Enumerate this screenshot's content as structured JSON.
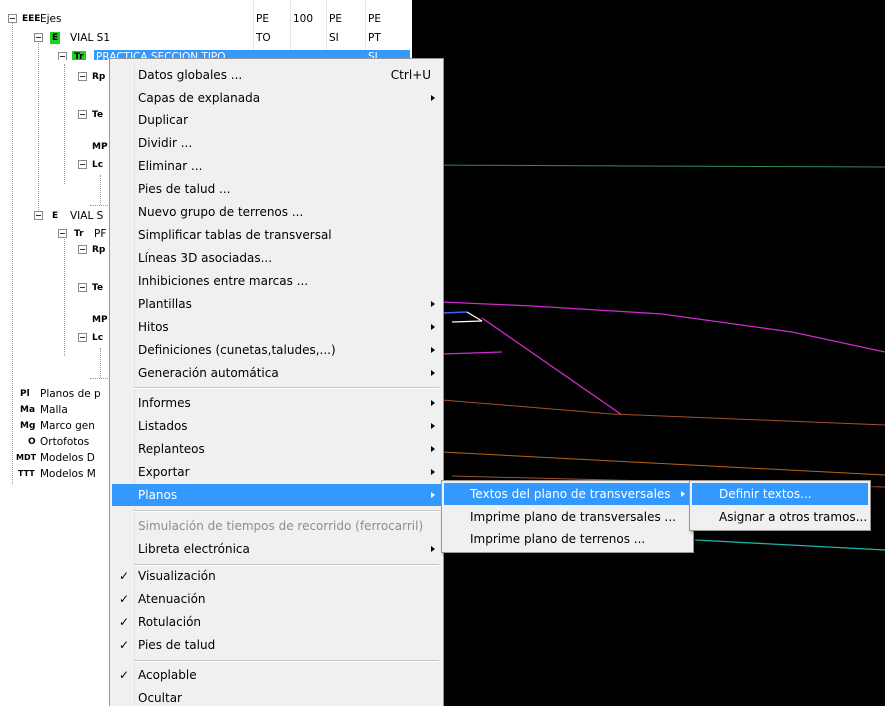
{
  "tree": {
    "rows": [
      {
        "icon": "EEE",
        "label": "Ejes",
        "c1": "PE",
        "c2": "100",
        "c3": "PE",
        "c4": "PE"
      },
      {
        "icon": "E",
        "label": "VIAL S1",
        "c1": "TO",
        "c2": "",
        "c3": "SI",
        "c4": "PT"
      },
      {
        "icon": "Tr",
        "label": "PRACTICA SECCION TIPO",
        "c1": "",
        "c2": "",
        "c3": "",
        "c4": "SI"
      },
      {
        "icon": "Rp",
        "label": "",
        "c1": "",
        "c2": "",
        "c3": "",
        "c4": ""
      },
      {
        "icon": "Te",
        "label": "",
        "c1": "",
        "c2": "",
        "c3": "",
        "c4": ""
      },
      {
        "icon": "MP",
        "label": "",
        "c1": "",
        "c2": "",
        "c3": "",
        "c4": ""
      },
      {
        "icon": "Lc",
        "label": "",
        "c1": "",
        "c2": "",
        "c3": "",
        "c4": ""
      },
      {
        "icon": "E",
        "label": "VIAL S",
        "c1": "",
        "c2": "",
        "c3": "",
        "c4": ""
      },
      {
        "icon": "Tr",
        "label": "PF",
        "c1": "",
        "c2": "",
        "c3": "",
        "c4": ""
      },
      {
        "icon": "Rp",
        "label": "",
        "c1": "",
        "c2": "",
        "c3": "",
        "c4": ""
      },
      {
        "icon": "Te",
        "label": "",
        "c1": "",
        "c2": "",
        "c3": "",
        "c4": ""
      },
      {
        "icon": "MP",
        "label": "",
        "c1": "",
        "c2": "",
        "c3": "",
        "c4": ""
      },
      {
        "icon": "Lc",
        "label": "",
        "c1": "",
        "c2": "",
        "c3": "",
        "c4": ""
      },
      {
        "icon": "Pl",
        "label": "Planos de p",
        "c1": "",
        "c2": "",
        "c3": "",
        "c4": ""
      },
      {
        "icon": "Ma",
        "label": "Malla",
        "c1": "",
        "c2": "",
        "c3": "",
        "c4": ""
      },
      {
        "icon": "Mg",
        "label": "Marco gen",
        "c1": "",
        "c2": "",
        "c3": "",
        "c4": ""
      },
      {
        "icon": "O",
        "label": "Ortofotos",
        "c1": "",
        "c2": "",
        "c3": "",
        "c4": ""
      },
      {
        "icon": "MDT",
        "label": "Modelos D",
        "c1": "",
        "c2": "",
        "c3": "",
        "c4": ""
      },
      {
        "icon": "TTT",
        "label": "Modelos M",
        "c1": "",
        "c2": "",
        "c3": "",
        "c4": ""
      }
    ]
  },
  "menu1": {
    "items": [
      {
        "label": "Datos globales ...",
        "shortcut": "Ctrl+U"
      },
      {
        "label": "Capas de explanada",
        "submenu": true
      },
      {
        "label": "Duplicar"
      },
      {
        "label": "Dividir ..."
      },
      {
        "label": "Eliminar ..."
      },
      {
        "label": "Pies de talud ..."
      },
      {
        "label": "Nuevo grupo de terrenos ..."
      },
      {
        "label": "Simplificar tablas de transversal"
      },
      {
        "label": "Líneas 3D asociadas..."
      },
      {
        "label": "Inhibiciones entre marcas ..."
      },
      {
        "label": "Plantillas",
        "submenu": true
      },
      {
        "label": "Hitos",
        "submenu": true
      },
      {
        "label": "Definiciones (cunetas,taludes,...)",
        "submenu": true
      },
      {
        "label": "Generación automática",
        "submenu": true
      },
      {
        "label": "Informes",
        "submenu": true
      },
      {
        "label": "Listados",
        "submenu": true
      },
      {
        "label": "Replanteos",
        "submenu": true
      },
      {
        "label": "Exportar",
        "submenu": true
      },
      {
        "label": "Planos",
        "submenu": true,
        "highlighted": true
      },
      {
        "label": "Simulación de tiempos de recorrido (ferrocarril)",
        "disabled": true
      },
      {
        "label": "Libreta electrónica",
        "submenu": true
      },
      {
        "label": "Visualización",
        "checked": true
      },
      {
        "label": "Atenuación",
        "checked": true
      },
      {
        "label": "Rotulación",
        "checked": true
      },
      {
        "label": "Pies de talud",
        "checked": true
      },
      {
        "label": "Acoplable",
        "checked": true
      },
      {
        "label": "Ocultar"
      }
    ]
  },
  "menu2": {
    "items": [
      {
        "label": "Textos del plano de transversales",
        "submenu": true,
        "highlighted": true
      },
      {
        "label": "Imprime plano de transversales ..."
      },
      {
        "label": "Imprime plano de terrenos ..."
      }
    ]
  },
  "menu3": {
    "items": [
      {
        "label": "Definir textos...",
        "highlighted": true
      },
      {
        "label": "Asignar a otros tramos..."
      }
    ]
  },
  "colors": {
    "menu_highlight": "#3399ff",
    "menu_background": "#f0f0f0",
    "tree_icon_green": "#1fd11f",
    "canvas_background": "#000000",
    "line_green": "#2e8b57",
    "line_magenta": "#d02bd0",
    "line_brown": "#a0522d",
    "line_cyan": "#20b2aa"
  }
}
